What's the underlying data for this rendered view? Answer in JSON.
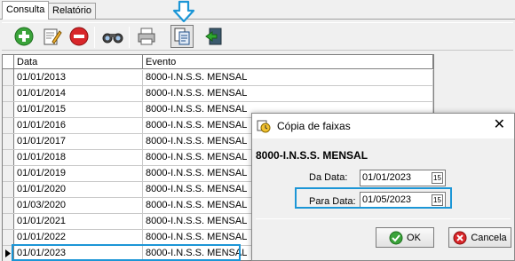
{
  "tabs": [
    {
      "label": "Consulta",
      "active": true
    },
    {
      "label": "Relatório",
      "active": false
    }
  ],
  "toolbar": {
    "buttons": [
      "add-icon",
      "edit-icon",
      "delete-icon",
      "search-binoculars-icon",
      "print-icon",
      "copy-icon",
      "exit-icon"
    ],
    "pressed": "copy-icon"
  },
  "grid": {
    "columns": [
      "Data",
      "Evento"
    ],
    "rows": [
      {
        "data": "01/01/2013",
        "evento": "8000-I.N.S.S. MENSAL"
      },
      {
        "data": "01/01/2014",
        "evento": "8000-I.N.S.S. MENSAL"
      },
      {
        "data": "01/01/2015",
        "evento": "8000-I.N.S.S. MENSAL"
      },
      {
        "data": "01/01/2016",
        "evento": "8000-I.N.S.S. MENSAL"
      },
      {
        "data": "01/01/2017",
        "evento": "8000-I.N.S.S. MENSAL"
      },
      {
        "data": "01/01/2018",
        "evento": "8000-I.N.S.S. MENSAL"
      },
      {
        "data": "01/01/2019",
        "evento": "8000-I.N.S.S. MENSAL"
      },
      {
        "data": "01/01/2020",
        "evento": "8000-I.N.S.S. MENSAL"
      },
      {
        "data": "01/03/2020",
        "evento": "8000-I.N.S.S. MENSAL"
      },
      {
        "data": "01/01/2021",
        "evento": "8000-I.N.S.S. MENSAL"
      },
      {
        "data": "01/01/2022",
        "evento": "8000-I.N.S.S. MENSAL"
      },
      {
        "data": "01/01/2023",
        "evento": "8000-I.N.S.S. MENSAL",
        "current": true
      }
    ]
  },
  "dialog": {
    "title": "Cópia de faixas",
    "heading": "8000-I.N.S.S. MENSAL",
    "da_data_label": "Da Data:",
    "da_data_value": "01/01/2023",
    "para_data_label": "Para Data:",
    "para_data_value": "01/05/2023",
    "calendar_glyph": "15",
    "ok_label": "OK",
    "cancel_label": "Cancela"
  },
  "colors": {
    "highlight": "#1c96d6"
  }
}
